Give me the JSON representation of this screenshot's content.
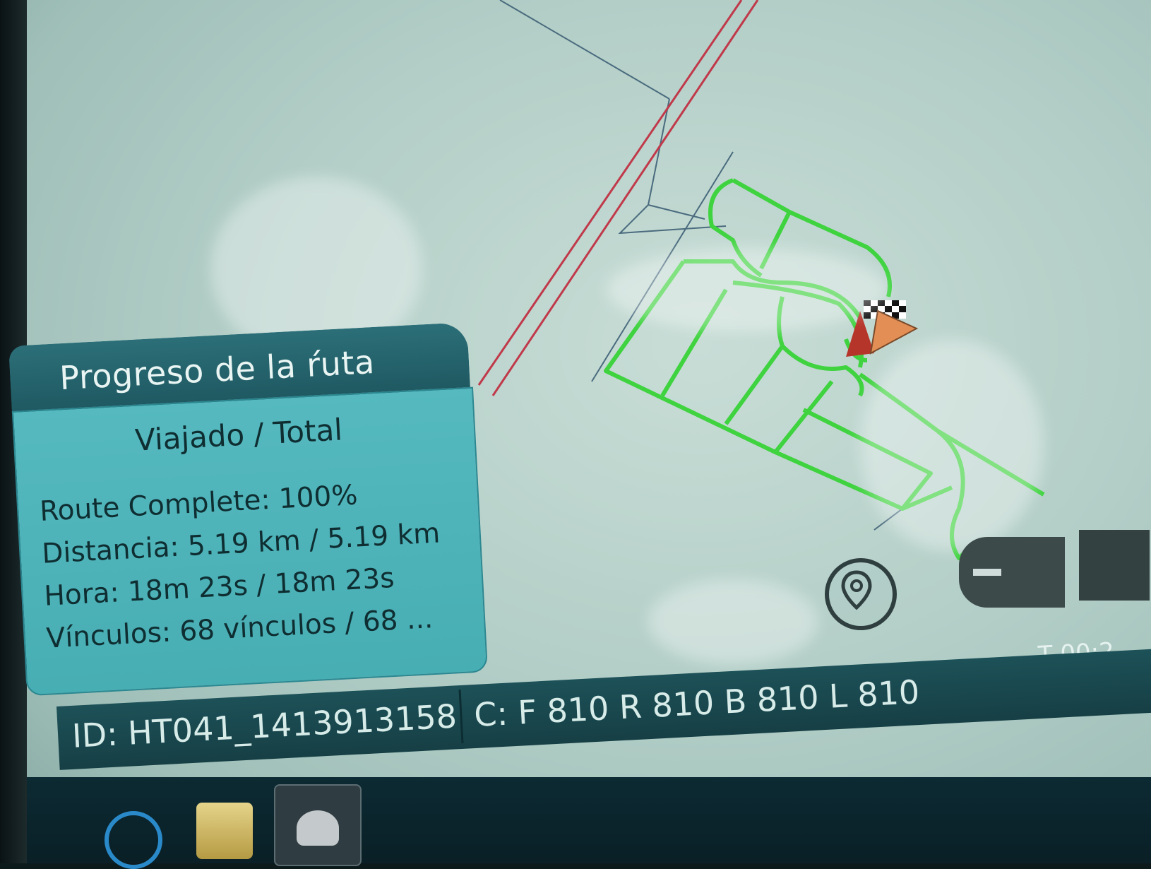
{
  "panel": {
    "title": "Progreso de la ŕuta",
    "subtitle": "Viajado / Total",
    "route_complete": "Route Complete: 100%",
    "distance": "Distancia: 5.19 km / 5.19 km",
    "time": "Hora: 18m 23s / 18m 23s",
    "links": "Vínculos: 68 vínculos / 68 ..."
  },
  "statusbar": {
    "id": "ID: HT041_1413913158",
    "counters": "C: F 810 R 810 B 810 L 810"
  },
  "timer": "T 00:2",
  "colors": {
    "route": "#3fd33f",
    "road_red": "#c0394a",
    "panel": "#4bb3b9",
    "statusbar": "#1a4a52"
  },
  "icons": {
    "location": "location-pin-icon",
    "zoom_out": "minus-icon",
    "finish": "checkered-flag-icon",
    "vehicle": "vehicle-arrow-icon"
  }
}
